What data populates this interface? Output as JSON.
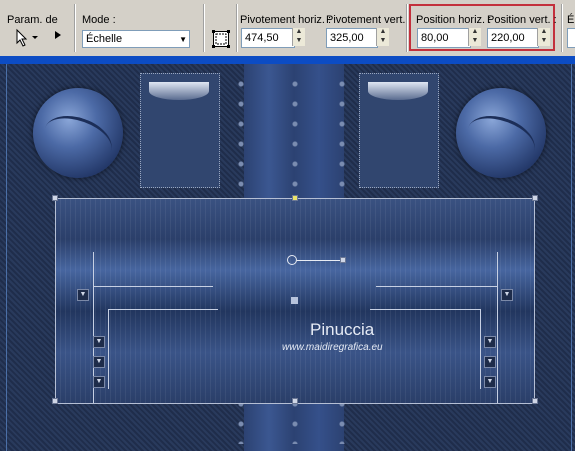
{
  "toolbar": {
    "preset_label": "Param. de",
    "mode_label": "Mode :",
    "mode_value": "Échelle",
    "pivot_h_label": "Pivotement horiz. :",
    "pivot_h_value": "474,50",
    "pivot_v_label": "Pivotement vert. :",
    "pivot_v_value": "325,00",
    "pos_h_label": "Position horiz. :",
    "pos_h_value": "80,00",
    "pos_v_label": "Position vert. :",
    "pos_v_value": "220,00",
    "cut_label": "É",
    "highlight_color": "#c3303c"
  },
  "icons": {
    "pointer": "mouse-pointer-icon",
    "expand": "triangle-right-icon",
    "transform": "transform-icon"
  },
  "watermark": {
    "name": "Pinuccia",
    "url": "www.maidiregrafica.eu"
  },
  "colors": {
    "canvas_bg": "#1f2d4b",
    "band": "#3a5282",
    "window_title_bar": "#0c4cc4"
  }
}
